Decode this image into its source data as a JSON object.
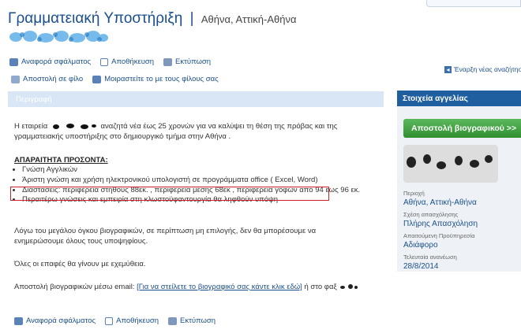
{
  "header": {
    "title": "Γραμματειακή Υποστήριξη",
    "separator": "|",
    "location": "Αθήνα, Αττική-Αθήνα"
  },
  "toolbar": {
    "report": "Αναφορά σφάλματος",
    "save": "Αποθήκευση",
    "print": "Εκτύπωση",
    "send_friend": "Αποστολή σε φίλο",
    "share_friends": "Μοιραστείτε το με τους φίλους σας"
  },
  "new_search": {
    "label": "Έναρξη νέας αναζήτησης"
  },
  "description": {
    "bar_label": "Περιγραφή",
    "intro_start": "Η εταιρεία",
    "intro_end": "αναζητά νέα έως 25 χρονών για να καλύψει τη θέση της πρόβας και της γραμματειακής υποστήριξης στο δημιουργικό τμήμα στην Αθήνα .",
    "requirements_heading": "ΑΠΑΡΑΙΤΗΤΑ ΠΡΟΣΟΝΤΑ:",
    "requirements": [
      "Γνώση Αγγλικών",
      "Άριστη γνώση και χρήση ηλεκτρονικού υπολογιστή σε προγράμματα office ( Excel, Word)",
      "Διαστάσεις: περιφέρεια στήθους 88εκ. , περιφέρεια μέσης 68εκ , περιφέρεια γοφών από 94 έως 96 εκ.",
      "Περαιτέρω γνώσεις και εμπειρία στη κλωστοϋφαντουργία θα ληφθούν υπόψη"
    ],
    "volume_note": "Λόγω του μεγάλου όγκου βιογραφικών, σε περίπτωση μη επιλογής, δεν θα μπορέσουμε να ενημερώσουμε όλους τους υποψηφίους.",
    "confidential": "Όλες οι επαφές θα γίνουν με εχεμύθεια.",
    "send_prefix": "Αποστολή βιογραφικών μέσω email:",
    "send_link": "[Για να στείλετε το βιογραφικό σας κάντε κλικ εδώ]",
    "send_suffix": "ή στο φαξ"
  },
  "sidebar": {
    "heading": "Στοιχεία αγγελίας",
    "cv_button": "Αποστολή βιογραφικού >>",
    "details": [
      {
        "label": "Περιοχή",
        "value": "Αθήνα, Αττική-Αθήνα"
      },
      {
        "label": "Σχέση απασχόλησης",
        "value": "Πλήρης Απασχόληση"
      },
      {
        "label": "Απαιτούμενη Προϋπηρεσία",
        "value": "Αδιάφορο"
      },
      {
        "label": "Τελευταία ανανέωση",
        "value": "28/8/2014"
      }
    ]
  },
  "colors": {
    "link_blue": "#1a4f8b",
    "sidebar_header": "#1f5fa0",
    "cv_button_green": "#3a9a3a",
    "highlight_red": "#d0202a",
    "description_bar": "#d9e6f5"
  }
}
